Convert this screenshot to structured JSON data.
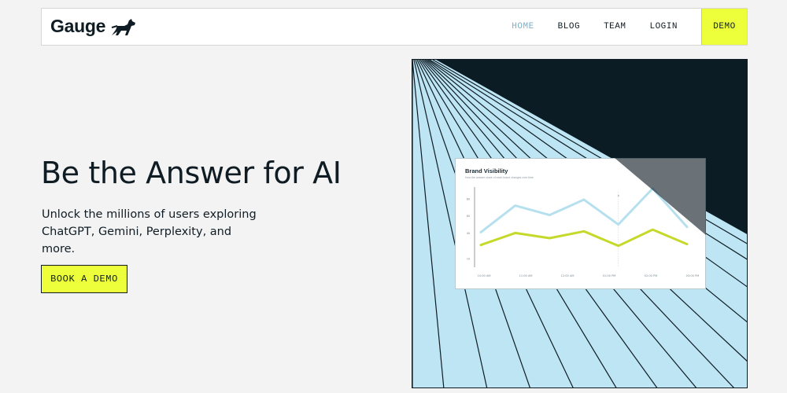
{
  "brand": {
    "name": "Gauge",
    "logo_icon": "dog-icon"
  },
  "nav": {
    "items": [
      {
        "label": "HOME",
        "active": true
      },
      {
        "label": "BLOG",
        "active": false
      },
      {
        "label": "TEAM",
        "active": false
      },
      {
        "label": "LOGIN",
        "active": false
      }
    ],
    "demo_label": "DEMO"
  },
  "hero": {
    "title": "Be the Answer for AI",
    "subtitle": "Unlock the millions of users exploring ChatGPT, Gemini, Perplexity, and more.",
    "cta_label": "BOOK A DEMO"
  },
  "colors": {
    "accent": "#ecff3a",
    "dark": "#0f1c24",
    "sky": "#bde5f4",
    "series_blue": "#b7e0ef",
    "series_green": "#c5d92a"
  },
  "chart_data": {
    "type": "line",
    "title": "Brand Visibility",
    "subtitle": "How the answer share of each brand changes over time",
    "x": [
      "10:00 AM",
      "11:00 AM",
      "12:00 AM",
      "01:00 PM",
      "02:00 PM",
      "03:00 PM"
    ],
    "y_ticks": [
      "80",
      "60",
      "40",
      "10"
    ],
    "ylim": [
      0,
      90
    ],
    "series": [
      {
        "values": [
          41,
          72,
          61,
          79,
          50,
          92,
          47
        ]
      },
      {
        "values": [
          26,
          40,
          34,
          42,
          25,
          44,
          27
        ]
      }
    ],
    "marker_label": "a"
  }
}
